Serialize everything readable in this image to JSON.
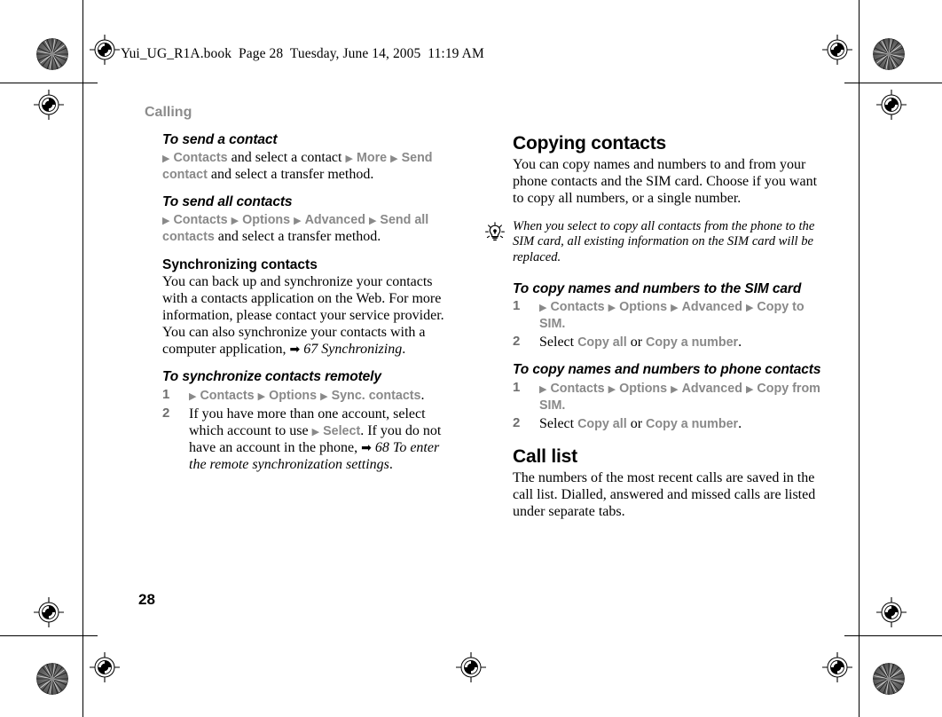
{
  "book_header": "Yui_UG_R1A.book  Page 28  Tuesday, June 14, 2005  11:19 AM",
  "running_head": "Calling",
  "page_number": "28",
  "colors": {
    "menu_gray": "#898989",
    "running_head_gray": "#8c8c8c",
    "list_number_gray": "#6e6e6e",
    "text_black": "#000000",
    "page_background": "#ffffff"
  },
  "icons": {
    "tip": "lightbulb-icon",
    "menu_marker": "right-triangle-icon",
    "cross_reference": "right-arrow-icon",
    "registration": "registration-target-icon",
    "starburst": "starburst-target-icon"
  },
  "left_column": {
    "send_contact": {
      "heading": "To send a contact",
      "menu_1": "Contacts",
      "text_1": " and select a contact ",
      "menu_2": "More",
      "menu_3": "Send contact",
      "text_2": " and select a transfer method."
    },
    "send_all_contacts": {
      "heading": "To send all contacts",
      "menu_1": "Contacts",
      "menu_2": "Options",
      "menu_3": "Advanced",
      "menu_4": "Send all contacts",
      "text_1": " and select a transfer method."
    },
    "synchronizing": {
      "heading": "Synchronizing contacts",
      "body": "You can back up and synchronize your contacts with a contacts application on the Web. For more information, please contact your service provider. You can also synchronize your contacts with a computer application, ",
      "reference": "67 Synchronizing",
      "period": "."
    },
    "sync_remotely": {
      "heading": "To synchronize contacts remotely",
      "steps": [
        {
          "num": "1",
          "menu_1": "Contacts",
          "menu_2": "Options",
          "menu_3": "Sync. contacts",
          "tail": "."
        },
        {
          "num": "2",
          "text_1": "If you have more than one account, select which account to use ",
          "menu_1": "Select",
          "text_2": ". If you do not have an account in the phone, ",
          "reference": "68 To enter the remote synchronization settings",
          "tail": "."
        }
      ]
    }
  },
  "right_column": {
    "copying_contacts": {
      "heading": "Copying contacts",
      "body": "You can copy names and numbers to and from your phone contacts and the SIM card. Choose if you want to copy all numbers, or a single number.",
      "tip": "When you select to copy all contacts from the phone to the SIM card, all existing information on the SIM card will be replaced."
    },
    "copy_to_sim": {
      "heading": "To copy names and numbers to the SIM card",
      "steps": [
        {
          "num": "1",
          "menu_1": "Contacts",
          "menu_2": "Options",
          "menu_3": "Advanced",
          "menu_4": "Copy to SIM",
          "tail": "."
        },
        {
          "num": "2",
          "text_1": "Select ",
          "menu_1": "Copy all",
          "text_2": " or ",
          "menu_2": "Copy a number",
          "tail": "."
        }
      ]
    },
    "copy_from_sim": {
      "heading": "To copy names and numbers to phone contacts",
      "steps": [
        {
          "num": "1",
          "menu_1": "Contacts",
          "menu_2": "Options",
          "menu_3": "Advanced",
          "menu_4": "Copy from SIM",
          "tail": "."
        },
        {
          "num": "2",
          "text_1": "Select ",
          "menu_1": "Copy all",
          "text_2": " or ",
          "menu_2": "Copy a number",
          "tail": "."
        }
      ]
    },
    "call_list": {
      "heading": "Call list",
      "body": "The numbers of the most recent calls are saved in the call list. Dialled, answered and missed calls are listed under separate tabs."
    }
  }
}
